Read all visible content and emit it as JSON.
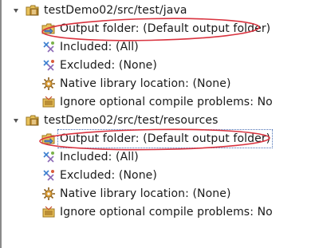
{
  "tree": {
    "groups": [
      {
        "folder": "testDemo02/src/test/java",
        "children": [
          "Output folder: (Default output folder)",
          "Included: (All)",
          "Excluded: (None)",
          "Native library location: (None)",
          "Ignore optional compile problems: No"
        ]
      },
      {
        "folder": "testDemo02/src/test/resources",
        "children": [
          "Output folder: (Default output folder)",
          "Included: (All)",
          "Excluded: (None)",
          "Native library location: (None)",
          "Ignore optional compile problems: No"
        ]
      }
    ]
  },
  "icons": {
    "expanded_twisty": "expanded-triangle-icon",
    "source_folder": "package-source-folder-icon",
    "output_folder": "output-folder-icon",
    "filter": "inclusion-exclusion-filter-icon",
    "native": "native-library-icon",
    "problems": "ignore-problems-icon"
  },
  "colors": {
    "annotation_oval": "#d9333f",
    "selection_border": "#4a6fb4"
  }
}
